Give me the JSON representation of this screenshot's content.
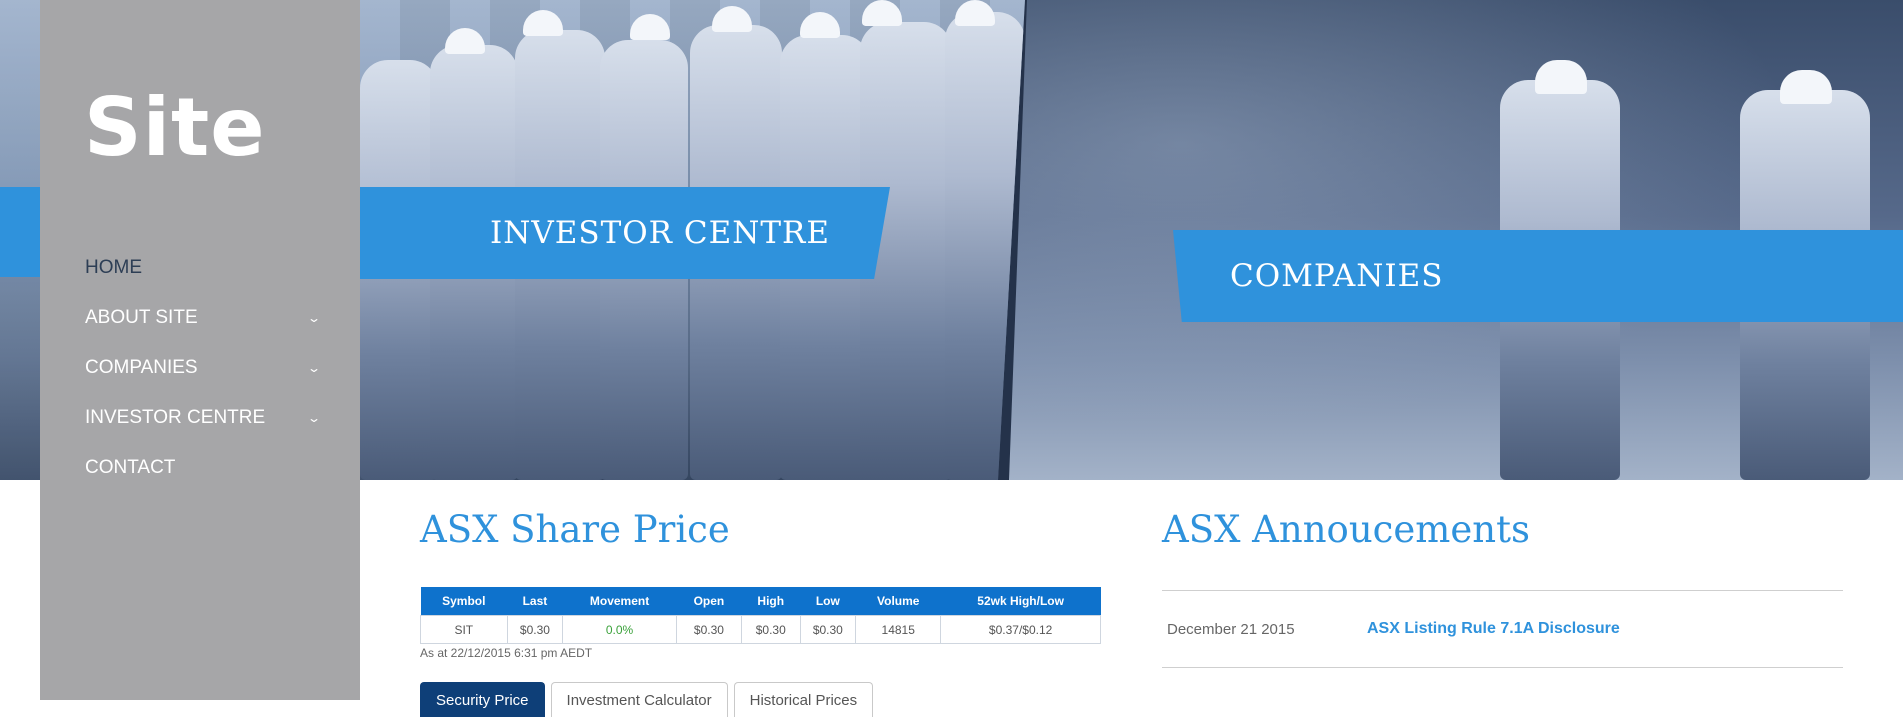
{
  "brand": {
    "logo": "Site",
    "accent_color": "#2f92dc",
    "sidebar_color": "#a6a6a8"
  },
  "nav": {
    "items": [
      {
        "label": "HOME",
        "has_submenu": false,
        "active": true
      },
      {
        "label": "ABOUT SITE",
        "has_submenu": true
      },
      {
        "label": "COMPANIES",
        "has_submenu": true
      },
      {
        "label": "INVESTOR CENTRE",
        "has_submenu": true
      },
      {
        "label": "CONTACT",
        "has_submenu": false
      }
    ],
    "submenu_icon": "chevron-down-icon"
  },
  "hero": {
    "investor_label": "INVESTOR CENTRE",
    "companies_label": "COMPANIES"
  },
  "share_price": {
    "title": "ASX Share Price",
    "columns": [
      "Symbol",
      "Last",
      "Movement",
      "Open",
      "High",
      "Low",
      "Volume",
      "52wk High/Low"
    ],
    "row": [
      "SIT",
      "$0.30",
      "0.0%",
      "$0.30",
      "$0.30",
      "$0.30",
      "14815",
      "$0.37/$0.12"
    ],
    "as_at": "As at 22/12/2015 6:31 pm AEDT",
    "tabs": [
      "Security Price",
      "Investment Calculator",
      "Historical Prices"
    ]
  },
  "announcements": {
    "title": "ASX Annoucements",
    "items": [
      {
        "date": "December 21 2015",
        "title": "ASX Listing Rule 7.1A Disclosure"
      }
    ]
  }
}
